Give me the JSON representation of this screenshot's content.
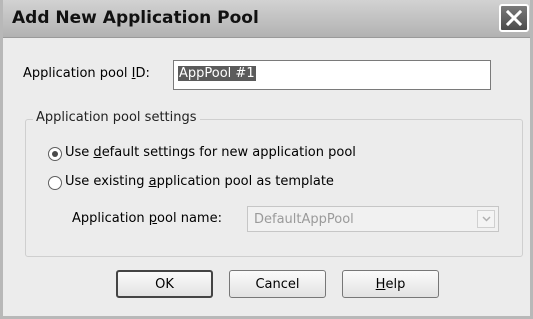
{
  "window": {
    "title": "Add New Application Pool",
    "close_icon": "close-icon"
  },
  "form": {
    "pool_id_label_pre": "Application pool ",
    "pool_id_label_key": "I",
    "pool_id_label_post": "D:",
    "pool_id_value": "AppPool #1"
  },
  "settings": {
    "group_title": "Application pool settings",
    "option_default": {
      "pre": "Use ",
      "key": "d",
      "post": "efault settings for new application pool",
      "selected": true
    },
    "option_existing": {
      "pre": "Use existing ",
      "key": "a",
      "post": "pplication pool as template",
      "selected": false
    },
    "pool_name_label_pre": "Application ",
    "pool_name_label_key": "p",
    "pool_name_label_post": "ool name:",
    "pool_name_value": "DefaultAppPool",
    "pool_name_enabled": false
  },
  "buttons": {
    "ok": "OK",
    "cancel": "Cancel",
    "help_key": "H",
    "help_post": "elp"
  }
}
